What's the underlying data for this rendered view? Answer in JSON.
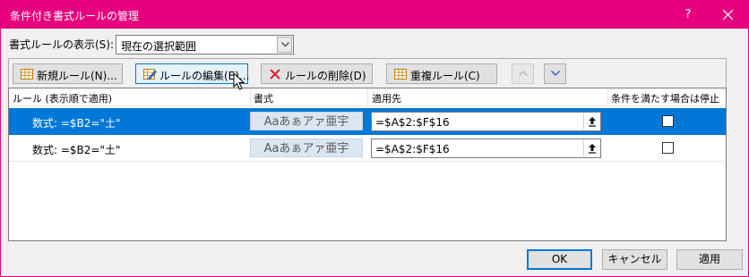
{
  "window": {
    "title": "条件付き書式ルールの管理",
    "help_label": "?",
    "accent": "#e6007e"
  },
  "show_rules": {
    "label": "書式ルールの表示(S):",
    "selected": "現在の選択範囲"
  },
  "toolbar": {
    "new_rule": "新規ルール(N)...",
    "edit_rule": "ルールの編集(E)...",
    "delete_rule": "ルールの削除(D)",
    "duplicate_rule": "重複ルール(C)"
  },
  "grid": {
    "columns": [
      "ルール (表示順で適用)",
      "書式",
      "適用先",
      "条件を満たす場合は停止"
    ],
    "rows": [
      {
        "rule": "数式: =$B2=\"土\"",
        "preview": "Aaあぁアァ亜宇",
        "applies_to": "=$A$2:$F$16",
        "stop_if_true": false,
        "selected": true
      },
      {
        "rule": "数式: =$B2=\"土\"",
        "preview": "Aaあぁアァ亜宇",
        "applies_to": "=$A$2:$F$16",
        "stop_if_true": false,
        "selected": false
      }
    ]
  },
  "footer": {
    "ok": "OK",
    "cancel": "キャンセル",
    "apply": "適用"
  },
  "colors": {
    "selection": "#0078d7",
    "preview_fill": "#dce6f1"
  }
}
